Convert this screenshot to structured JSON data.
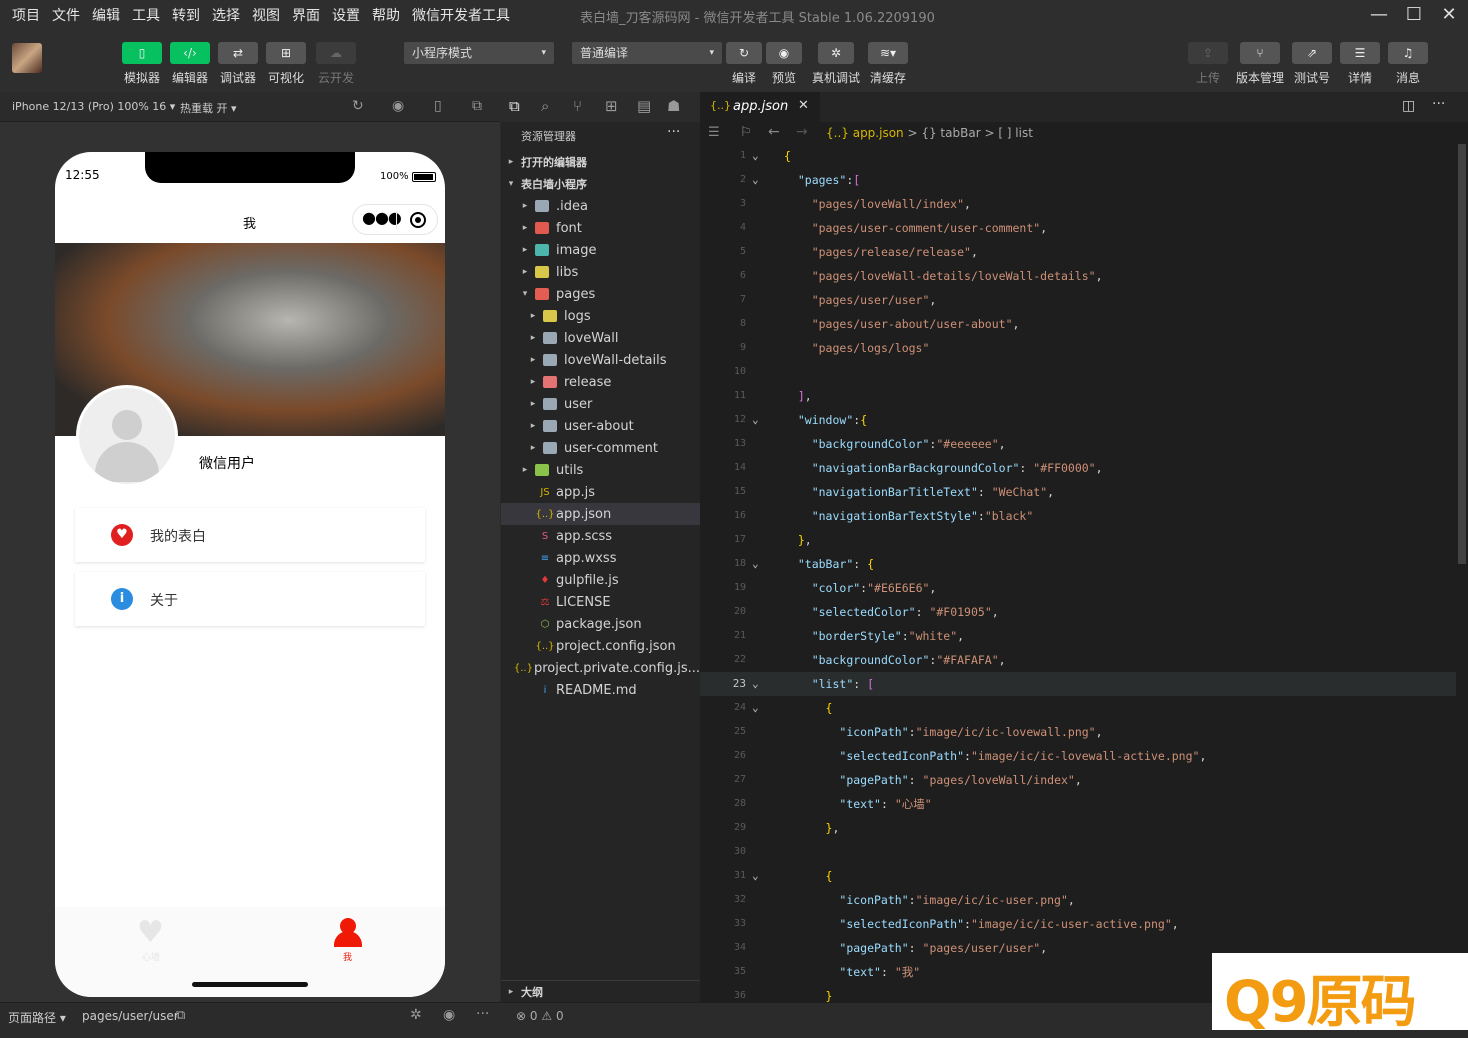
{
  "menubar": {
    "items": [
      "项目",
      "文件",
      "编辑",
      "工具",
      "转到",
      "选择",
      "视图",
      "界面",
      "设置",
      "帮助",
      "微信开发者工具"
    ],
    "title": "表白墙_刀客源码网 - 微信开发者工具 Stable 1.06.2209190"
  },
  "toolbar": {
    "left": [
      "模拟器",
      "编辑器",
      "调试器",
      "可视化",
      "云开发"
    ],
    "mode": "小程序模式",
    "compile": "普通编译",
    "mid": [
      "编译",
      "预览",
      "真机调试",
      "清缓存"
    ],
    "right": [
      "上传",
      "版本管理",
      "测试号",
      "详情",
      "消息"
    ]
  },
  "simbar": {
    "device": "iPhone 12/13 (Pro) 100% 16 ▾",
    "hotreload": "热重载 开 ▾"
  },
  "phone": {
    "time": "12:55",
    "battery": "100%",
    "nav_title": "我",
    "username": "微信用户",
    "menu": [
      "我的表白",
      "关于"
    ],
    "tabs": [
      "心墙",
      "我"
    ],
    "colors": {
      "accent": "#f01905",
      "inactive": "#e6e6e6"
    }
  },
  "explorer": {
    "title": "资源管理器",
    "open_editors": "打开的编辑器",
    "project": "表白墙小程序",
    "outline": "大纲",
    "items": [
      {
        "label": ".idea",
        "depth": 1,
        "type": "folder",
        "color": "#9aa7b5"
      },
      {
        "label": "font",
        "depth": 1,
        "type": "folder",
        "color": "#e05a4f"
      },
      {
        "label": "image",
        "depth": 1,
        "type": "folder",
        "color": "#4db6ac"
      },
      {
        "label": "libs",
        "depth": 1,
        "type": "folder",
        "color": "#d8c84a"
      },
      {
        "label": "pages",
        "depth": 1,
        "type": "folder-open",
        "color": "#e35d52"
      },
      {
        "label": "logs",
        "depth": 2,
        "type": "folder",
        "color": "#d8c84a"
      },
      {
        "label": "loveWall",
        "depth": 2,
        "type": "folder",
        "color": "#9aa7b5"
      },
      {
        "label": "loveWall-details",
        "depth": 2,
        "type": "folder",
        "color": "#9aa7b5"
      },
      {
        "label": "release",
        "depth": 2,
        "type": "folder",
        "color": "#e57373"
      },
      {
        "label": "user",
        "depth": 2,
        "type": "folder",
        "color": "#9aa7b5"
      },
      {
        "label": "user-about",
        "depth": 2,
        "type": "folder",
        "color": "#9aa7b5"
      },
      {
        "label": "user-comment",
        "depth": 2,
        "type": "folder",
        "color": "#9aa7b5"
      },
      {
        "label": "utils",
        "depth": 1,
        "type": "folder",
        "color": "#8bc34a"
      },
      {
        "label": "app.js",
        "depth": 1,
        "type": "file",
        "icon": "JS",
        "color": "#d6b600"
      },
      {
        "label": "app.json",
        "depth": 1,
        "type": "file",
        "icon": "{..}",
        "color": "#d6b600",
        "active": true
      },
      {
        "label": "app.scss",
        "depth": 1,
        "type": "file",
        "icon": "S",
        "color": "#e05a8a"
      },
      {
        "label": "app.wxss",
        "depth": 1,
        "type": "file",
        "icon": "≡",
        "color": "#42a5f5"
      },
      {
        "label": "gulpfile.js",
        "depth": 1,
        "type": "file",
        "icon": "♦",
        "color": "#e53935"
      },
      {
        "label": "LICENSE",
        "depth": 1,
        "type": "file",
        "icon": "⚖",
        "color": "#e53935"
      },
      {
        "label": "package.json",
        "depth": 1,
        "type": "file",
        "icon": "⬡",
        "color": "#8bc34a"
      },
      {
        "label": "project.config.json",
        "depth": 1,
        "type": "file",
        "icon": "{..}",
        "color": "#d6b600"
      },
      {
        "label": "project.private.config.js...",
        "depth": 1,
        "type": "file",
        "icon": "{..}",
        "color": "#d6b600"
      },
      {
        "label": "README.md",
        "depth": 1,
        "type": "file",
        "icon": "i",
        "color": "#42a5f5"
      }
    ]
  },
  "editor": {
    "tab": "app.json",
    "breadcrumb": [
      "{..} app.json",
      ">",
      "{} tabBar",
      ">",
      "[ ] list"
    ],
    "current_line": 23,
    "lines": [
      "{",
      "  \"pages\":[",
      "    \"pages/loveWall/index\",",
      "    \"pages/user-comment/user-comment\",",
      "    \"pages/release/release\",",
      "    \"pages/loveWall-details/loveWall-details\",",
      "    \"pages/user/user\",",
      "    \"pages/user-about/user-about\",",
      "    \"pages/logs/logs\"",
      "",
      "  ],",
      "  \"window\":{",
      "    \"backgroundColor\":\"#eeeeee\",",
      "    \"navigationBarBackgroundColor\": \"#FF0000\",",
      "    \"navigationBarTitleText\": \"WeChat\",",
      "    \"navigationBarTextStyle\":\"black\"",
      "  },",
      "  \"tabBar\": {",
      "    \"color\":\"#E6E6E6\",",
      "    \"selectedColor\": \"#F01905\",",
      "    \"borderStyle\":\"white\",",
      "    \"backgroundColor\":\"#FAFAFA\",",
      "    \"list\": [",
      "      {",
      "        \"iconPath\":\"image/ic/ic-lovewall.png\",",
      "        \"selectedIconPath\":\"image/ic/ic-lovewall-active.png\",",
      "        \"pagePath\": \"pages/loveWall/index\",",
      "        \"text\": \"心墙\"",
      "      },",
      "",
      "      {",
      "        \"iconPath\":\"image/ic/ic-user.png\",",
      "        \"selectedIconPath\":\"image/ic/ic-user-active.png\",",
      "        \"pagePath\": \"pages/user/user\",",
      "        \"text\": \"我\"",
      "      }"
    ]
  },
  "status": {
    "path_label": "页面路径 ▾",
    "path": "pages/user/user",
    "errors": "0",
    "warnings": "0"
  },
  "watermark": {
    "text": "Q9原码"
  }
}
